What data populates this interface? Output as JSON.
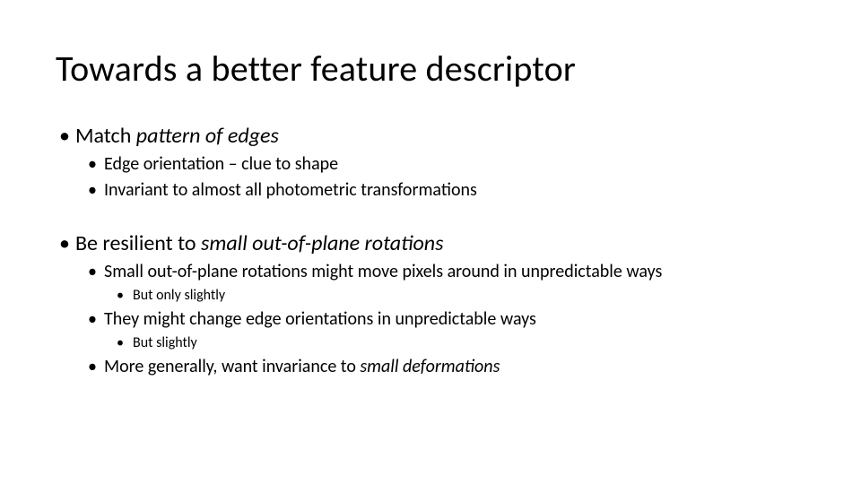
{
  "title": "Towards a better feature descriptor",
  "body": {
    "item1": {
      "prefix": "Match ",
      "italic": "pattern of edges",
      "sub1": "Edge orientation – clue to shape",
      "sub2": "Invariant to almost all photometric transformations"
    },
    "item2": {
      "prefix": "Be resilient to ",
      "italic": "small out-of-plane rotations",
      "sub1": "Small out-of-plane rotations might move pixels around in unpredictable ways",
      "sub1_sub": "But only slightly",
      "sub2": "They might change edge orientations in unpredictable ways",
      "sub2_sub": "But slightly",
      "sub3_prefix": "More generally, want invariance to ",
      "sub3_italic": "small deformations"
    }
  }
}
